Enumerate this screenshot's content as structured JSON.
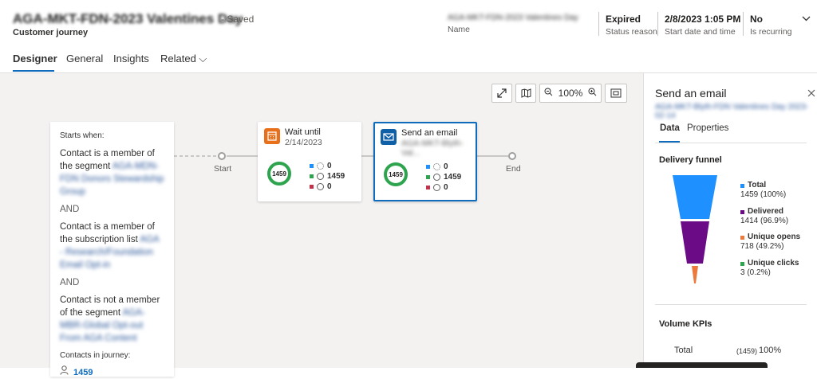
{
  "header": {
    "title": "AGA-MKT-FDN-2023 Valentines Day",
    "saved": "- Saved",
    "subtitle": "Customer journey",
    "fields": [
      {
        "value": "AGA-MKT-FDN-2023 Valentines Day",
        "label": "Name"
      },
      {
        "value": "Expired",
        "label": "Status reason"
      },
      {
        "value": "2/8/2023 1:05 PM",
        "label": "Start date and time"
      },
      {
        "value": "No",
        "label": "Is recurring"
      }
    ],
    "expand_icon": "chevron-down-icon"
  },
  "tabs": [
    {
      "label": "Designer",
      "active": true
    },
    {
      "label": "General"
    },
    {
      "label": "Insights"
    },
    {
      "label": "Related ⌵"
    }
  ],
  "toolbar": {
    "zoom": "100%",
    "icons": [
      "expand-icon",
      "map-icon",
      "zoom-out-icon",
      "zoom-in-icon",
      "fit-icon"
    ]
  },
  "start_card": {
    "starts_when": "Starts when:",
    "c1_prefix": "Contact is a member of the segment",
    "c1_link": "AGA-MDN-FDN Donors Stewardship Group",
    "and1": "AND",
    "c2_prefix": "Contact is a member of the subscription list",
    "c2_link": "AGA - Research/Foundation Email Opt-in",
    "and2": "AND",
    "c3_prefix": "Contact is not a member of the segment",
    "c3_link": "AGA-MBR-Global Opt-out From AGA Content",
    "contacts_label": "Contacts in journey:",
    "contacts_count": "1459"
  },
  "flow": {
    "start": "Start",
    "end": "End"
  },
  "wait_node": {
    "title": "Wait until",
    "sub": "2/14/2023",
    "ring": "1459",
    "stats": [
      "0",
      "1459",
      "0"
    ]
  },
  "email_node": {
    "title": "Send an email",
    "sub": "AGA-MKT-Blyth-Val...",
    "ring": "1459",
    "stats": [
      "0",
      "1459",
      "0"
    ]
  },
  "panel": {
    "title": "Send an email",
    "sub": "AGA-MKT-Blyth-FDN Valentines Day 2023-02-14",
    "tabs": [
      "Data",
      "Properties"
    ],
    "funnel_title": "Delivery funnel",
    "legend": [
      {
        "name": "Total",
        "value": "1459 (100%)",
        "color": "#1f90ff"
      },
      {
        "name": "Delivered",
        "value": "1414 (96.9%)",
        "color": "#6b0c86"
      },
      {
        "name": "Unique opens",
        "value": "718 (49.2%)",
        "color": "#ec7a3c"
      },
      {
        "name": "Unique clicks",
        "value": "3 (0.2%)",
        "color": "#2ea44f"
      }
    ],
    "kpi_title": "Volume KPIs",
    "kpi_row": {
      "label": "Total",
      "count": "(1459)",
      "pct": "100%"
    }
  }
}
